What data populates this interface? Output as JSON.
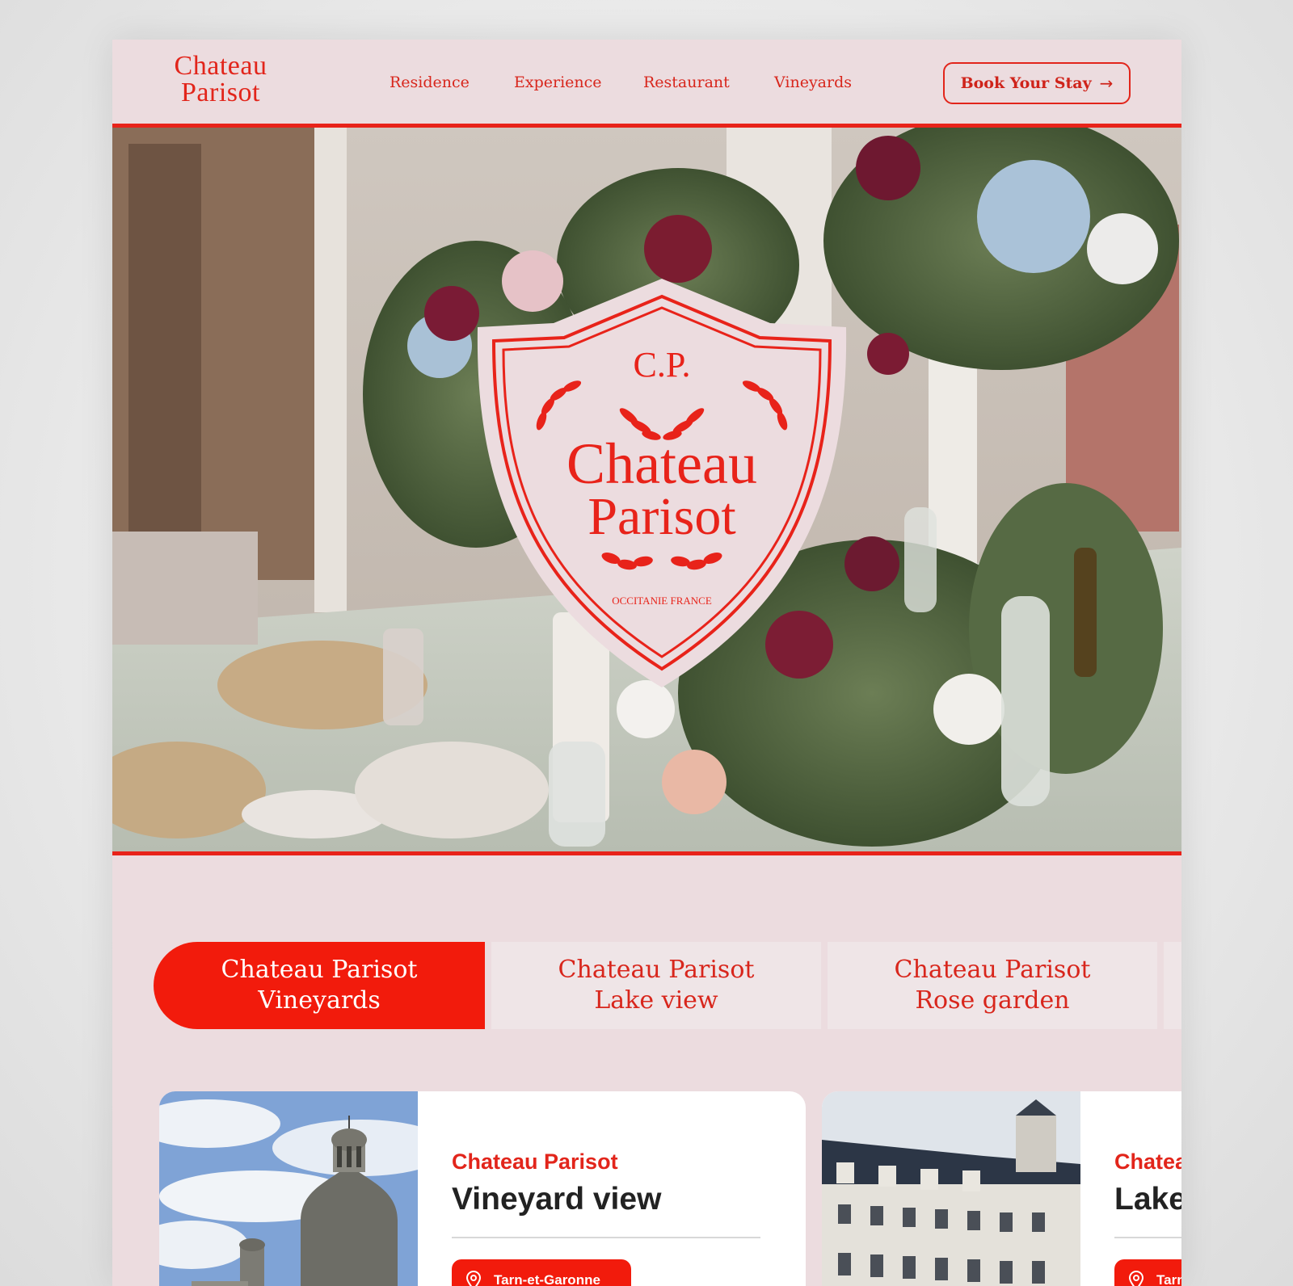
{
  "brand": {
    "logo_line1": "Chateau",
    "logo_line2": "Parisot",
    "accent": "#e2251b",
    "background": "#ecdcdf"
  },
  "nav": {
    "items": [
      "Residence",
      "Experience",
      "Restaurant",
      "Vineyards"
    ]
  },
  "header": {
    "cta_label": "Book Your Stay",
    "cta_icon": "arrow-right-icon"
  },
  "hero": {
    "crest": {
      "monogram": "C.P.",
      "line1": "Chateau",
      "line2": "Parisot",
      "region": "OCCITANIE FRANCE"
    }
  },
  "tabs": [
    {
      "line1": "Chateau Parisot",
      "line2": "Vineyards",
      "active": true
    },
    {
      "line1": "Chateau Parisot",
      "line2": "Lake view",
      "active": false
    },
    {
      "line1": "Chateau Parisot",
      "line2": "Rose garden",
      "active": false
    }
  ],
  "cards": [
    {
      "eyebrow": "Chateau Parisot",
      "title": "Vineyard view",
      "location": "Tarn-et-Garonne",
      "location_icon": "map-pin-icon"
    },
    {
      "eyebrow": "Chateau Parisot",
      "title": "Lake view",
      "location": "Tarn-et-Garonne",
      "location_icon": "map-pin-icon"
    }
  ]
}
